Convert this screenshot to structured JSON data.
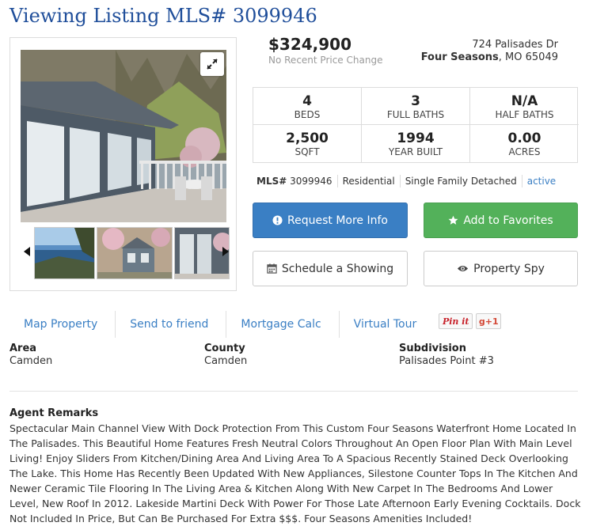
{
  "page": {
    "title": "Viewing Listing MLS# 3099946"
  },
  "photo": {
    "main_caption": "",
    "expand_icon": "expand-icon",
    "thumbs": [
      {
        "name": "thumb-lake-view"
      },
      {
        "name": "thumb-house-exterior"
      },
      {
        "name": "thumb-deck-sliders"
      }
    ],
    "arrow_left": "◀",
    "arrow_right": "▶"
  },
  "price": {
    "amount": "$324,900",
    "note": "No Recent Price Change"
  },
  "address": {
    "street": "724 Palisades Dr",
    "city": "Four Seasons",
    "state_zip": ", MO 65049"
  },
  "stats": [
    {
      "value": "4",
      "label": "BEDS"
    },
    {
      "value": "3",
      "label": "FULL BATHS"
    },
    {
      "value": "N/A",
      "label": "HALF BATHS"
    },
    {
      "value": "2,500",
      "label": "SQFT"
    },
    {
      "value": "1994",
      "label": "YEAR BUILT"
    },
    {
      "value": "0.00",
      "label": "ACRES"
    }
  ],
  "mls_bar": {
    "mls_label": "MLS#",
    "mls_number": "3099946",
    "type": "Residential",
    "subtype": "Single Family Detached",
    "status": "active"
  },
  "buttons": {
    "request_info": "Request More Info",
    "favorites": "Add to Favorites",
    "schedule": "Schedule a Showing",
    "spy": "Property Spy"
  },
  "links": {
    "map": "Map Property",
    "send": "Send to friend",
    "mortgage": "Mortgage Calc",
    "tour": "Virtual Tour",
    "pinterest": "Pin it",
    "gplus": "g+1"
  },
  "info": {
    "area_label": "Area",
    "area_value": "Camden",
    "county_label": "County",
    "county_value": "Camden",
    "subdivision_label": "Subdivision",
    "subdivision_value": "Palisades Point #3"
  },
  "remarks": {
    "heading": "Agent Remarks",
    "text": "Spectacular Main Channel View With Dock Protection From This Custom Four Seasons Waterfront Home Located In The Palisades. This Beautiful Home Features Fresh Neutral Colors Throughout An Open Floor Plan With Main Level Living! Enjoy Sliders From Kitchen/Dining Area And Living Area To A Spacious Recently Stained Deck Overlooking The Lake. This Home Has Recently Been Updated With New Appliances, Silestone Counter Tops In The Kitchen And Newer Ceramic Tile Flooring In The Living Area & Kitchen Along With New Carpet In The Bedrooms And Lower Level, New Roof In 2012. Lakeside Martini Deck With Power For Those Late Afternoon Early Evening Cocktails. Dock Not Included In Price, But Can Be Purchased For Extra $$$. Four Seasons Amenities Included!"
  },
  "colors": {
    "title": "#1f4e9a",
    "link": "#3a7fc4",
    "primary_button": "#3a7fc4",
    "success_button": "#53b15a"
  }
}
